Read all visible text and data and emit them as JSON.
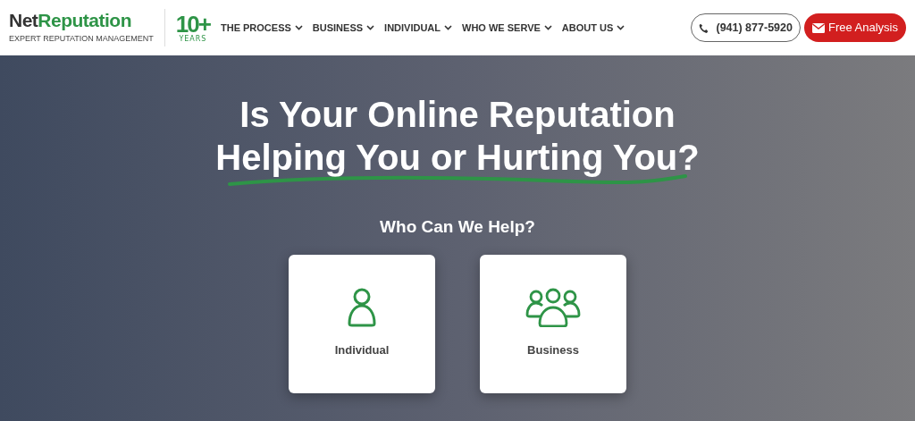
{
  "logo": {
    "name_dark": "Net",
    "name_green": "Reputation",
    "tagline": "EXPERT REPUTATION MANAGEMENT"
  },
  "years_badge": {
    "number": "10+",
    "label": "YEARS"
  },
  "nav": [
    {
      "label": "THE PROCESS"
    },
    {
      "label": "BUSINESS"
    },
    {
      "label": "INDIVIDUAL"
    },
    {
      "label": "WHO WE SERVE"
    },
    {
      "label": "ABOUT US"
    }
  ],
  "phone_button": "(941) 877-5920",
  "cta_button": "Free Analysis",
  "hero": {
    "title_lines": [
      "Is Your Online Reputation",
      "Helping You or Hurting You?"
    ],
    "subtitle": "Who Can We Help?",
    "cards": [
      {
        "label": "Individual",
        "kind": "person"
      },
      {
        "label": "Business",
        "kind": "group"
      }
    ]
  }
}
